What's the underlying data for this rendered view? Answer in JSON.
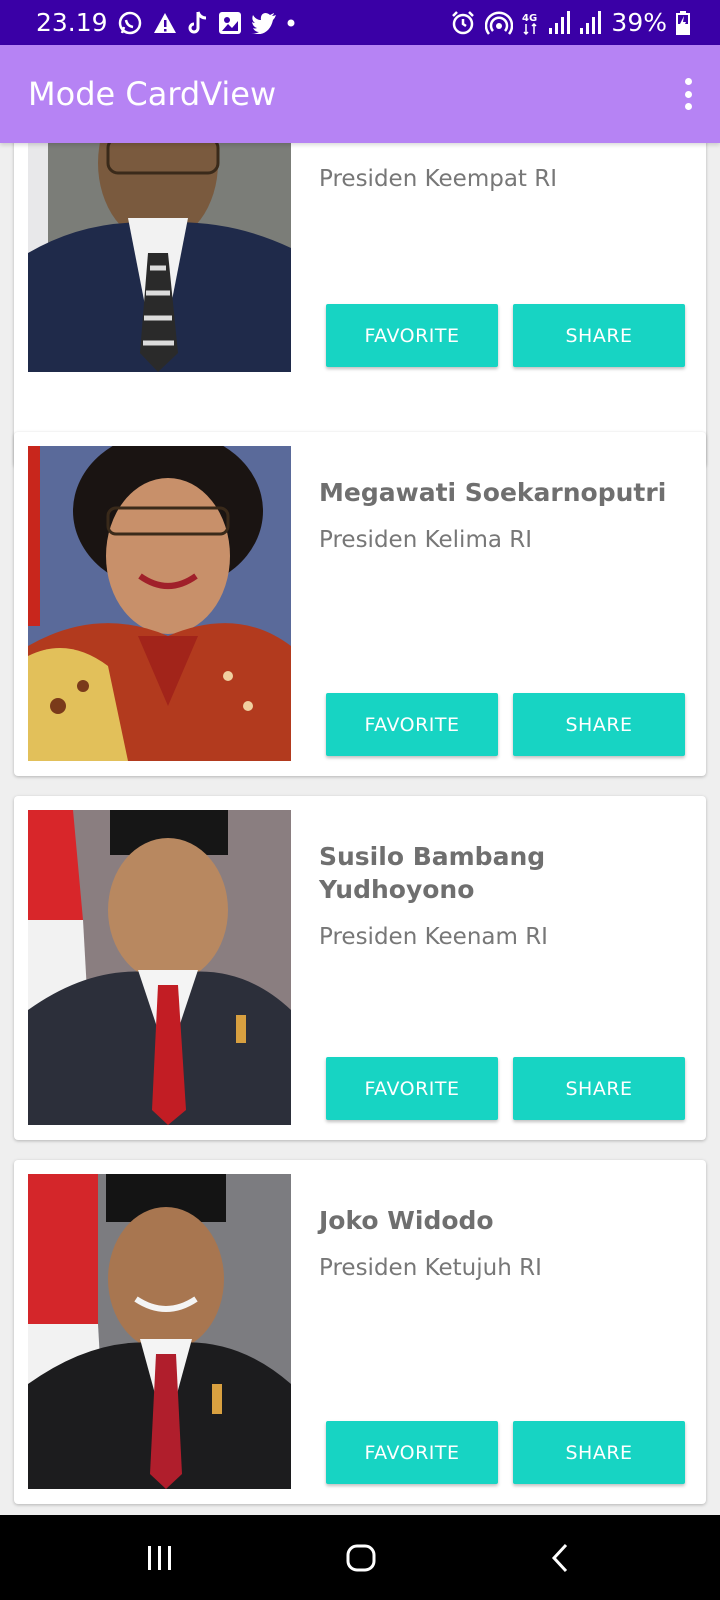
{
  "status_bar": {
    "time": "23.19",
    "battery": "39%",
    "left_icons": [
      "whatsapp-icon",
      "alert-icon",
      "tiktok-icon",
      "gallery-icon",
      "twitter-icon",
      "dot-icon"
    ],
    "right_icons": [
      "alarm-icon",
      "hotspot-icon",
      "4g-icon",
      "signal-icon",
      "signal-icon",
      "battery-icon"
    ]
  },
  "app_bar": {
    "title": "Mode CardView",
    "menu_icon": "more-vert-icon",
    "color": "#b683f4"
  },
  "colors": {
    "status_bar": "#3a00a6",
    "button": "#17d4c3",
    "button_text": "#ffffff"
  },
  "cards": [
    {
      "name": "",
      "role": "Presiden Keempat RI",
      "favorite_label": "FAVORITE",
      "share_label": "SHARE"
    },
    {
      "name": "Megawati Soekarnoputri",
      "role": "Presiden Kelima RI",
      "favorite_label": "FAVORITE",
      "share_label": "SHARE"
    },
    {
      "name": "Susilo Bambang Yudhoyono",
      "role": "Presiden Keenam RI",
      "favorite_label": "FAVORITE",
      "share_label": "SHARE"
    },
    {
      "name": "Joko Widodo",
      "role": "Presiden Ketujuh RI",
      "favorite_label": "FAVORITE",
      "share_label": "SHARE"
    }
  ],
  "nav_bar": {
    "recents_icon": "recents-icon",
    "home_icon": "home-icon",
    "back_icon": "back-icon"
  }
}
